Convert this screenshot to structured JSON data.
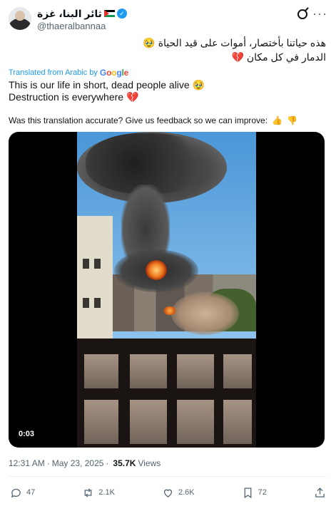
{
  "author": {
    "display_name": "ثائر البنا، غزة",
    "handle": "@thaeralbannaa",
    "verified_icon": "check-icon",
    "flag": "palestine-flag-icon"
  },
  "tweet": {
    "original_text_line1": "هذه حياتنا بأختصار، أموات على قيد الحياة 🥹",
    "original_text_line2": "الدمار في كل مكان 💔",
    "translated_from_label": "Translated from Arabic by",
    "translation_line1": "This is our life in short, dead people alive 🥹",
    "translation_line2": "Destruction is everywhere 💔",
    "feedback_prompt": "Was this translation accurate? Give us feedback so we can improve:"
  },
  "google_logo": {
    "g1": "G",
    "g2": "o",
    "g3": "o",
    "g4": "g",
    "g5": "l",
    "g6": "e"
  },
  "media": {
    "video_time": "0:03"
  },
  "meta": {
    "time": "12:31 AM",
    "separator": "·",
    "date": "May 23, 2025",
    "views_count": "35.7K",
    "views_label": "Views"
  },
  "actions": {
    "replies": "47",
    "reposts": "2.1K",
    "likes": "2.6K",
    "bookmarks": "72"
  },
  "colors": {
    "link_blue": "#1d9bf0",
    "muted_gray": "#536471",
    "text_dark": "#0f1419"
  }
}
